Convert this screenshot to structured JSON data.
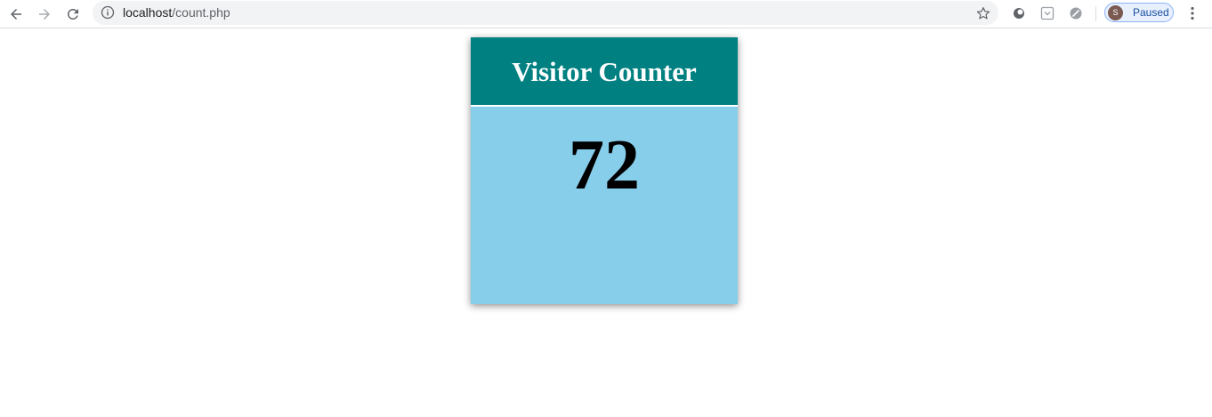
{
  "browser": {
    "url_host": "localhost",
    "url_path": "/count.php",
    "profile_initial": "S",
    "profile_status": "Paused",
    "colors": {
      "toolbar_bg": "#ffffff",
      "omnibox_bg": "#f1f3f4",
      "profile_accent": "#1a4fa0"
    },
    "icons": [
      "back-arrow-icon",
      "forward-arrow-icon",
      "reload-icon",
      "info-icon",
      "star-icon",
      "extension-circle-icon",
      "extension-pocket-icon",
      "extension-block-icon",
      "kebab-menu-icon"
    ]
  },
  "counter": {
    "title": "Visitor Counter",
    "value": "72",
    "colors": {
      "header_bg": "#008080",
      "body_bg": "#87ceeb",
      "title_color": "#ffffff",
      "value_color": "#000000"
    }
  }
}
